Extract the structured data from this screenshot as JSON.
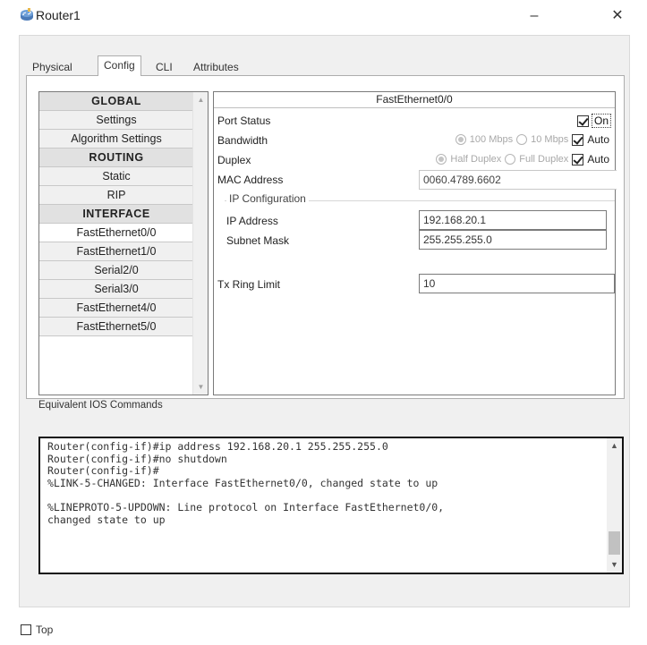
{
  "window": {
    "title": "Router1",
    "minimize_glyph": "–",
    "close_glyph": "✕",
    "icon": "router-icon"
  },
  "tabs": [
    {
      "label": "Physical",
      "active": false
    },
    {
      "label": "Config",
      "active": true
    },
    {
      "label": "CLI",
      "active": false
    },
    {
      "label": "Attributes",
      "active": false
    }
  ],
  "nav": {
    "items": [
      {
        "label": "GLOBAL",
        "header": true
      },
      {
        "label": "Settings",
        "header": false
      },
      {
        "label": "Algorithm Settings",
        "header": false
      },
      {
        "label": "ROUTING",
        "header": true
      },
      {
        "label": "Static",
        "header": false
      },
      {
        "label": "RIP",
        "header": false
      },
      {
        "label": "INTERFACE",
        "header": true
      },
      {
        "label": "FastEthernet0/0",
        "header": false,
        "selected": true
      },
      {
        "label": "FastEthernet1/0",
        "header": false
      },
      {
        "label": "Serial2/0",
        "header": false
      },
      {
        "label": "Serial3/0",
        "header": false
      },
      {
        "label": "FastEthernet4/0",
        "header": false
      },
      {
        "label": "FastEthernet5/0",
        "header": false
      }
    ]
  },
  "config": {
    "title": "FastEthernet0/0",
    "port_status": {
      "label": "Port Status",
      "on_label": "On",
      "checked": true
    },
    "bandwidth": {
      "label": "Bandwidth",
      "opt1": "100 Mbps",
      "opt2": "10 Mbps",
      "auto_label": "Auto",
      "auto_checked": true
    },
    "duplex": {
      "label": "Duplex",
      "opt1": "Half Duplex",
      "opt2": "Full Duplex",
      "auto_label": "Auto",
      "auto_checked": true
    },
    "mac": {
      "label": "MAC Address",
      "value": "0060.4789.6602"
    },
    "ip_config": {
      "legend": "IP Configuration",
      "ip_label": "IP Address",
      "ip_value": "192.168.20.1",
      "mask_label": "Subnet Mask",
      "mask_value": "255.255.255.0"
    },
    "tx_ring": {
      "label": "Tx Ring Limit",
      "value": "10"
    }
  },
  "ios": {
    "label": "Equivalent IOS Commands",
    "lines": [
      "Router(config-if)#ip address 192.168.20.1 255.255.255.0",
      "Router(config-if)#no shutdown",
      "Router(config-if)#",
      "%LINK-5-CHANGED: Interface FastEthernet0/0, changed state to up",
      "",
      "%LINEPROTO-5-UPDOWN: Line protocol on Interface FastEthernet0/0,",
      "changed state to up"
    ]
  },
  "footer": {
    "top_label": "Top",
    "top_checked": false
  }
}
